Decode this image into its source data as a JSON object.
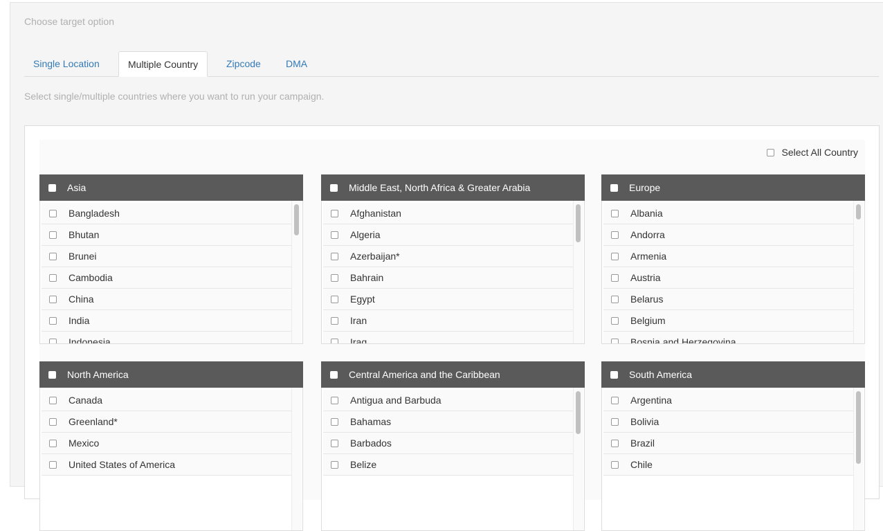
{
  "heading": "Choose target option",
  "tabs": [
    {
      "label": "Single Location"
    },
    {
      "label": "Multiple Country"
    },
    {
      "label": "Zipcode"
    },
    {
      "label": "DMA"
    }
  ],
  "active_tab": "Multiple Country",
  "description": "Select single/multiple countries where you want to run your campaign.",
  "select_all_label": "Select All Country",
  "regions": [
    {
      "name": "Asia",
      "countries": [
        "Bangladesh",
        "Bhutan",
        "Brunei",
        "Cambodia",
        "China",
        "India",
        "Indonesia"
      ]
    },
    {
      "name": "Middle East, North Africa & Greater Arabia",
      "countries": [
        "Afghanistan",
        "Algeria",
        "Azerbaijan*",
        "Bahrain",
        "Egypt",
        "Iran",
        "Iraq"
      ]
    },
    {
      "name": "Europe",
      "countries": [
        "Albania",
        "Andorra",
        "Armenia",
        "Austria",
        "Belarus",
        "Belgium",
        "Bosnia and Herzegovina"
      ]
    },
    {
      "name": "North America",
      "countries": [
        "Canada",
        "Greenland*",
        "Mexico",
        "United States of America"
      ]
    },
    {
      "name": "Central America and the Caribbean",
      "countries": [
        "Antigua and Barbuda",
        "Bahamas",
        "Barbados",
        "Belize"
      ]
    },
    {
      "name": "South America",
      "countries": [
        "Argentina",
        "Bolivia",
        "Brazil",
        "Chile"
      ]
    }
  ]
}
